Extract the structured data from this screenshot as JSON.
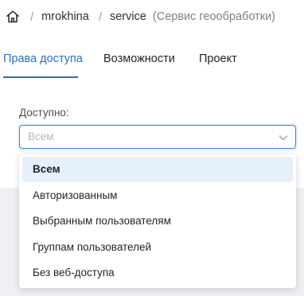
{
  "breadcrumb": {
    "home_icon": "home-icon",
    "separator": "/",
    "items": [
      "mrokhina",
      "service"
    ],
    "description": "(Сервис геообработки)"
  },
  "tabs": [
    {
      "label": "Права доступа",
      "active": true
    },
    {
      "label": "Возможности",
      "active": false
    },
    {
      "label": "Проект",
      "active": false
    }
  ],
  "access": {
    "label": "Доступно:",
    "placeholder": "Всем",
    "chevron_icon": "chevron-down-icon",
    "options": [
      {
        "label": "Всем",
        "selected": true
      },
      {
        "label": "Авторизованным",
        "selected": false
      },
      {
        "label": "Выбранным пользователям",
        "selected": false
      },
      {
        "label": "Группам пользователей",
        "selected": false
      },
      {
        "label": "Без веб-доступа",
        "selected": false
      }
    ]
  },
  "colors": {
    "accent": "#2a6fc9",
    "selected_option_bg": "#e6f0fb",
    "input_border_focus": "#3a86e6"
  }
}
